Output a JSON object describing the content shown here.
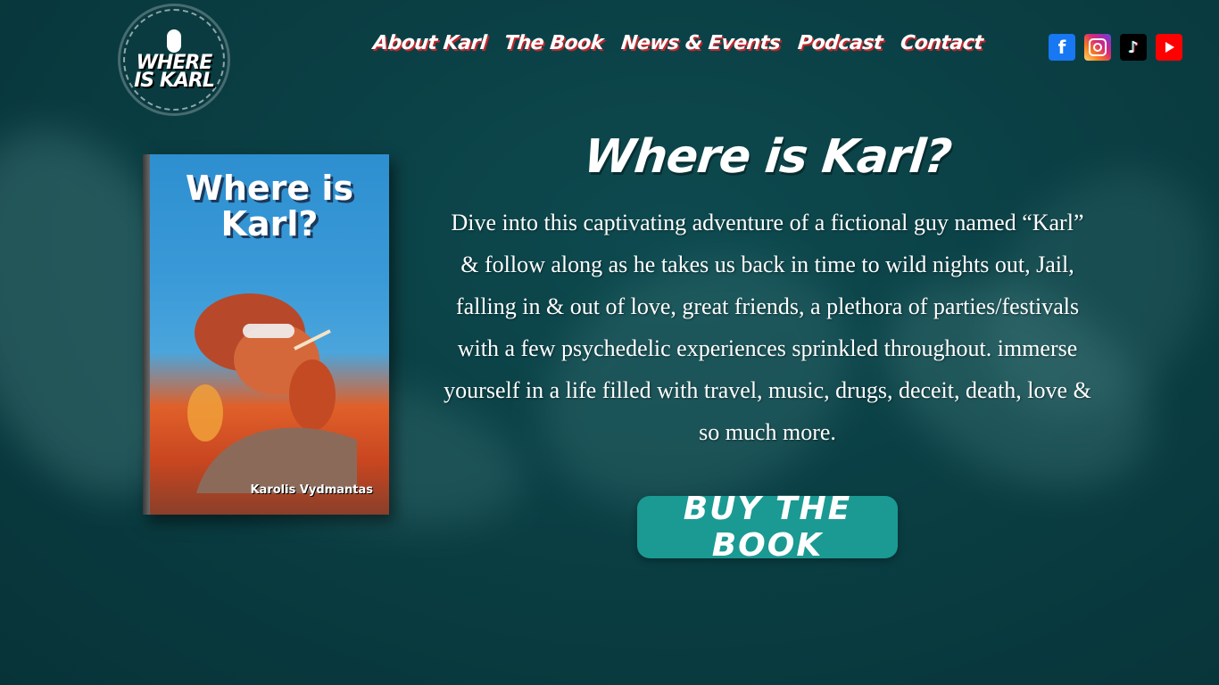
{
  "logo": {
    "text": "WHERE\nIS KARL"
  },
  "nav": {
    "items": [
      {
        "label": "About Karl"
      },
      {
        "label": "The Book"
      },
      {
        "label": "News & Events"
      },
      {
        "label": "Podcast"
      },
      {
        "label": "Contact"
      }
    ]
  },
  "social": {
    "facebook_glyph": "f",
    "tiktok_glyph": "♪",
    "icons": [
      "facebook-icon",
      "instagram-icon",
      "tiktok-icon",
      "youtube-icon"
    ]
  },
  "book_cover": {
    "title": "Where is\nKarl?",
    "author": "Karolis Vydmantas"
  },
  "main": {
    "headline": "Where is Karl?",
    "description": "Dive into this captivating adventure of a fictional guy named “Karl” & follow along as he takes us back in time to wild nights out, Jail, falling in & out of love, great friends, a plethora of parties/festivals with a few psychedelic experiences sprinkled throughout. immerse yourself in a life filled with travel, music, drugs, deceit, death, love & so much more.",
    "buy_button_label": "BUY THE BOOK"
  },
  "colors": {
    "background": "#0a3f44",
    "nav_accent": "#c2262b",
    "button": "#1a9a92"
  }
}
